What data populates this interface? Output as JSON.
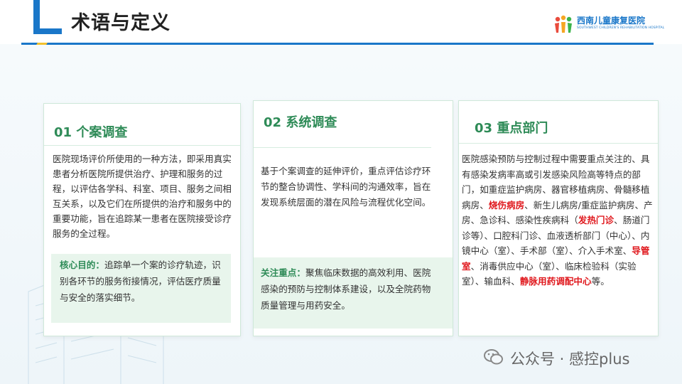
{
  "header": {
    "title": "术语与定义",
    "logo_name": "西南儿童康复医院",
    "logo_subtitle": "SOUTHWEST CHILDREN'S REHABILITATION HOSPITAL"
  },
  "colors": {
    "accent_blue": "#1a77c9",
    "accent_yellow": "#f2c12e",
    "green": "#2e8b57",
    "highlight_red": "#e0191e"
  },
  "cards": [
    {
      "title": "01 个案调查",
      "body": "医院现场评价所使用的一种方法，即采用真实患者分析医院所提供治疗、护理和服务的过程，以评估各学科、科室、项目、服务之间相互关系，以及它们在所提供的治疗和服务中的重要功能，旨在追踪某一患者在医院接受诊疗服务的全过程。",
      "note_label": "核心目的：",
      "note_text": "追踪单一个案的诊疗轨迹，识别各环节的服务衔接情况，评估医疗质量与安全的落实细节。"
    },
    {
      "title": "02 系统调查",
      "body": "基于个案调查的延伸评价，重点评估诊疗环节的整合协调性、学科间的沟通效率，旨在发现系统层面的潜在风险与流程优化空间。",
      "note_label": "关注重点：",
      "note_text": "聚焦临床数据的高效利用、医院感染的预防与控制体系建设，以及全院药物质量管理与用药安全。"
    },
    {
      "title": "03 重点部门",
      "body_parts": [
        "医院感染预防与控制过程中需要重点关注的、具有感染发病率高或引发感染风险高等特点的部门，如重症监护病房、器官移植病房、骨髓移植病房、",
        "烧伤病房",
        "、新生儿病房/重症监护病房、产房、急诊科、感染性疾病科（",
        "发热门诊",
        "、肠道门诊等）、口腔科门诊、血液透析部门（中心）、内镜中心（室）、手术部（室）、介入手术室、",
        "导管室",
        "、消毒供应中心（室）、临床检验科（实验室）、输血科、",
        "静脉用药调配中心",
        "等。"
      ]
    }
  ],
  "watermark": {
    "text": "公众号 · 感控plus",
    "icon": "wechat-icon"
  }
}
